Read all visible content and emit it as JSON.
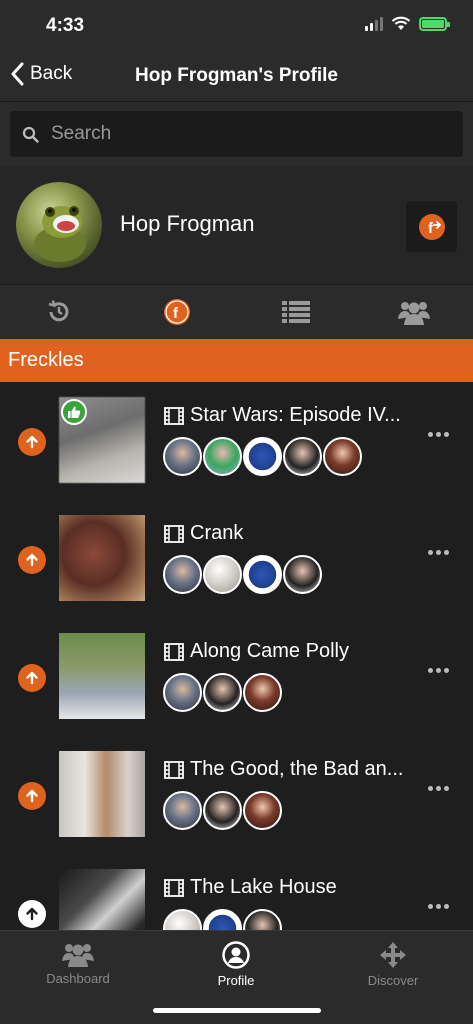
{
  "status": {
    "time": "4:33"
  },
  "nav": {
    "back_label": "Back",
    "title": "Hop Frogman's Profile"
  },
  "search": {
    "placeholder": "Search"
  },
  "profile": {
    "name": "Hop Frogman"
  },
  "tabs": [
    "history-icon",
    "freckles-icon",
    "list-icon",
    "group-icon"
  ],
  "section": {
    "title": "Freckles"
  },
  "items": [
    {
      "title": "Star Wars: Episode IV...",
      "liked": true,
      "up_color": "orange"
    },
    {
      "title": "Crank",
      "liked": false,
      "up_color": "orange"
    },
    {
      "title": "Along Came Polly",
      "liked": false,
      "up_color": "orange"
    },
    {
      "title": "The Good, the Bad an...",
      "liked": false,
      "up_color": "orange"
    },
    {
      "title": "The Lake House",
      "liked": false,
      "up_color": "white"
    }
  ],
  "bottom_nav": {
    "dashboard": "Dashboard",
    "profile": "Profile",
    "discover": "Discover"
  },
  "colors": {
    "accent": "#e0621f",
    "like": "#3ba33b",
    "battery": "#4cd964"
  }
}
